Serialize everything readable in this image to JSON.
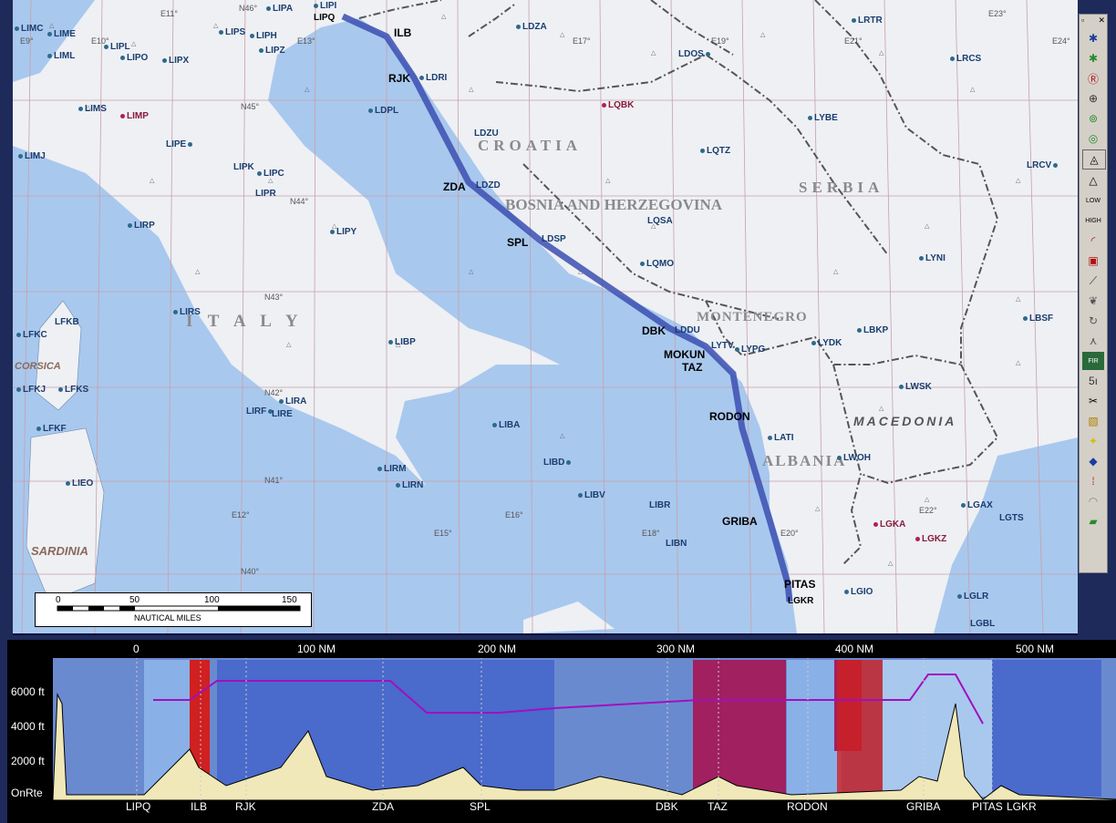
{
  "map": {
    "countries": [
      "CROATIA",
      "BOSNIA AND HERZEGOVINA",
      "SERBIA",
      "MONTENEGRO",
      "MACEDONIA",
      "ALBANIA",
      "I T A L Y",
      "CORSICA",
      "SARDINIA"
    ],
    "grid_labels": [
      "E9°",
      "E10°",
      "E11°",
      "E12°",
      "E13°",
      "E15°",
      "E16°",
      "E17°",
      "E18°",
      "E19°",
      "E20°",
      "E21°",
      "E22°",
      "E23°",
      "E24°",
      "N46°",
      "N45°",
      "N44°",
      "N43°",
      "N42°",
      "N41°",
      "N40°"
    ],
    "airports": [
      "LIPI",
      "LIMC",
      "LIME",
      "LIPL",
      "LIPA",
      "LIPS",
      "LIPH",
      "LIPQ",
      "LIML",
      "LIPO",
      "LIPX",
      "LIPZ",
      "LDZA",
      "LDOS",
      "LRTR",
      "LRCS",
      "LIMS",
      "LIMP",
      "LDPL",
      "LDRI",
      "LQBK",
      "LYBE",
      "LDZU",
      "LIPE",
      "LIMJ",
      "LIPK",
      "LIPC",
      "LQTZ",
      "LRCV",
      "LDZD",
      "LIPR",
      "LQSA",
      "LIRP",
      "LIPY",
      "LDSP",
      "LYNI",
      "LQMO",
      "LIRS",
      "LFKB",
      "LDDU",
      "LBSF",
      "LFKC",
      "LIBP",
      "LYTV",
      "LYPG",
      "LYDK",
      "LBKP",
      "LFKJ",
      "LFKS",
      "LIRA",
      "LWSK",
      "LIRF",
      "LIRE",
      "LFKF",
      "LIBA",
      "LATI",
      "LIRM",
      "LIBD",
      "LWOH",
      "LIEO",
      "LIRN",
      "LIBV",
      "LIBR",
      "LGAX",
      "LGTS",
      "LGKA",
      "LGKZ",
      "LIBN",
      "LGIO",
      "LGLR",
      "LGBL"
    ],
    "red_airports": [
      "LIMP",
      "LQBK",
      "LGKA",
      "LGKZ"
    ],
    "waypoints": [
      "ILB",
      "RJK",
      "ZDA",
      "SPL",
      "DBK",
      "MOKUN",
      "TAZ",
      "RODON",
      "GRIBA",
      "PITAS",
      "LGKR",
      "LIPQ"
    ]
  },
  "scalebar": {
    "ticks": [
      "0",
      "50",
      "100",
      "150"
    ],
    "unit": "NAUTICAL MILES"
  },
  "profile": {
    "distance_labels": [
      "0",
      "100 NM",
      "200 NM",
      "300 NM",
      "400 NM",
      "500 NM"
    ],
    "altitude_labels": [
      "6000 ft",
      "4000 ft",
      "2000 ft",
      "OnRte"
    ],
    "route_labels": [
      "LIPQ",
      "ILB",
      "RJK",
      "ZDA",
      "SPL",
      "DBK",
      "TAZ",
      "RODON",
      "GRIBA",
      "PITAS",
      "LGKR"
    ]
  },
  "toolbar": {
    "icons": [
      "restore-icon",
      "close-icon",
      "settings-icon",
      "settings-green-icon",
      "airway-icon",
      "vor-icon",
      "ndb-icon",
      "ndb2-icon",
      "triangle-icon",
      "waypoint-icon",
      "low-icon",
      "high-icon",
      "range-icon",
      "restricted-icon",
      "runway-icon",
      "terrain-icon",
      "wind-icon",
      "route-icon",
      "fir-icon",
      "labels-icon",
      "cut-icon",
      "pattern-icon",
      "star-icon",
      "nav-icon",
      "signal-icon",
      "radar-icon"
    ]
  },
  "colors": {
    "sea": "#a9c8ee",
    "land": "#eef0f4",
    "route": "#3b4fb0",
    "grid": "#c8a0a8",
    "terrain": "#f0e8b8"
  }
}
